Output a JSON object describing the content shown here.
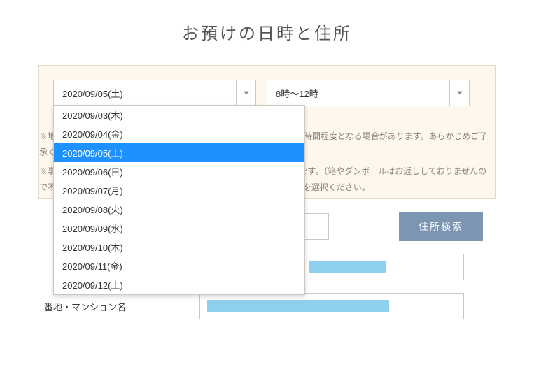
{
  "title": "お預けの日時と住所",
  "date_select": {
    "value": "2020/09/05(土)",
    "options": [
      "2020/09/03(木)",
      "2020/09/04(金)",
      "2020/09/05(土)",
      "2020/09/06(日)",
      "2020/09/07(月)",
      "2020/09/08(火)",
      "2020/09/09(水)",
      "2020/09/10(木)",
      "2020/09/11(金)",
      "2020/09/12(土)"
    ],
    "selected_index": 2
  },
  "time_select": {
    "value": "8時～12時"
  },
  "note1": "※地域や交通事情等により、ご希望に添えない、集荷時間の幅が前後1時間程度となる場合があります。あらかじめご了承ください。",
  "note2": "※事前に袋や箱などに衣類をまとめていただくと引き渡しがスムーズです。（箱やダンボールはお返ししておりませんので不要なものでお願いします。）ご用意が難しい場合は下記オプションを選択ください。",
  "search_button": "住所検索",
  "label_address2": "番地・マンション名"
}
